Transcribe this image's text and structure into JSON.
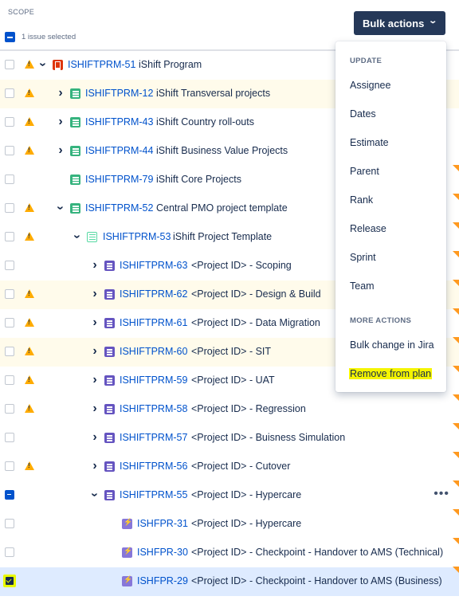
{
  "header": {
    "scope_label": "SCOPE",
    "selection_text": "1 issue selected",
    "bulk_actions_label": "Bulk actions"
  },
  "rows": [
    {
      "key": "ISHIFTPRM-51",
      "summary": "iShift Program",
      "type": "initiative",
      "warning": true,
      "expand": "down",
      "checkbox": "empty",
      "highlight": false,
      "flag": false
    },
    {
      "key": "ISHIFTPRM-12",
      "summary": "iShift Transversal projects",
      "type": "program",
      "warning": true,
      "expand": "right",
      "checkbox": "empty",
      "highlight": true,
      "flag": false
    },
    {
      "key": "ISHIFTPRM-43",
      "summary": "iShift Country roll-outs",
      "type": "program",
      "warning": true,
      "expand": "right",
      "checkbox": "empty",
      "highlight": false,
      "flag": false
    },
    {
      "key": "ISHIFTPRM-44",
      "summary": "iShift Business Value Projects",
      "type": "program",
      "warning": true,
      "expand": "right",
      "checkbox": "empty",
      "highlight": false,
      "flag": false
    },
    {
      "key": "ISHIFTPRM-79",
      "summary": "iShift Core Projects",
      "type": "program",
      "warning": false,
      "expand": "none",
      "checkbox": "empty",
      "highlight": false,
      "flag": true
    },
    {
      "key": "ISHIFTPRM-52",
      "summary": "Central PMO project template",
      "type": "program",
      "warning": true,
      "expand": "down",
      "checkbox": "empty",
      "highlight": false,
      "flag": true
    },
    {
      "key": "ISHIFTPRM-53",
      "summary": "iShift Project Template",
      "type": "program-light",
      "warning": true,
      "expand": "down",
      "checkbox": "empty",
      "highlight": false,
      "flag": true
    },
    {
      "key": "ISHIFTPRM-63",
      "summary": "<Project ID> - Scoping",
      "type": "epic",
      "warning": false,
      "expand": "right",
      "checkbox": "empty",
      "highlight": false,
      "flag": true
    },
    {
      "key": "ISHIFTPRM-62",
      "summary": "<Project ID> - Design & Build",
      "type": "epic",
      "warning": true,
      "expand": "right",
      "checkbox": "empty",
      "highlight": true,
      "flag": true
    },
    {
      "key": "ISHIFTPRM-61",
      "summary": "<Project ID> - Data Migration",
      "type": "epic",
      "warning": true,
      "expand": "right",
      "checkbox": "empty",
      "highlight": false,
      "flag": true
    },
    {
      "key": "ISHIFTPRM-60",
      "summary": "<Project ID> - SIT",
      "type": "epic",
      "warning": true,
      "expand": "right",
      "checkbox": "empty",
      "highlight": true,
      "flag": true
    },
    {
      "key": "ISHIFTPRM-59",
      "summary": "<Project ID> - UAT",
      "type": "epic",
      "warning": true,
      "expand": "right",
      "checkbox": "empty",
      "highlight": false,
      "flag": true
    },
    {
      "key": "ISHIFTPRM-58",
      "summary": "<Project ID> - Regression",
      "type": "epic",
      "warning": true,
      "expand": "right",
      "checkbox": "empty",
      "highlight": false,
      "flag": true
    },
    {
      "key": "ISHIFTPRM-57",
      "summary": "<Project ID> - Buisness Simulation",
      "type": "epic",
      "warning": false,
      "expand": "right",
      "checkbox": "empty",
      "highlight": false,
      "flag": true
    },
    {
      "key": "ISHIFTPRM-56",
      "summary": "<Project ID> - Cutover",
      "type": "epic",
      "warning": true,
      "expand": "right",
      "checkbox": "empty",
      "highlight": false,
      "flag": true
    },
    {
      "key": "ISHIFTPRM-55",
      "summary": "<Project ID> - Hypercare",
      "type": "epic",
      "warning": false,
      "expand": "down",
      "checkbox": "minus",
      "highlight": false,
      "flag": true,
      "more": true
    },
    {
      "key": "ISHFPR-31",
      "summary": "<Project ID> - Hypercare",
      "type": "task",
      "warning": false,
      "expand": "none",
      "checkbox": "empty",
      "highlight": false,
      "flag": true
    },
    {
      "key": "ISHFPR-30",
      "summary": "<Project ID> - Checkpoint - Handover to AMS (Technical)",
      "type": "task",
      "warning": false,
      "expand": "none",
      "checkbox": "empty",
      "highlight": false,
      "flag": true
    },
    {
      "key": "ISHFPR-29",
      "summary": "<Project ID> - Checkpoint - Handover to AMS (Business)",
      "type": "task",
      "warning": false,
      "expand": "none",
      "checkbox": "checked",
      "highlight": false,
      "selected": true,
      "flag": true
    }
  ],
  "menu": {
    "update_heading": "UPDATE",
    "update_items": [
      "Assignee",
      "Dates",
      "Estimate",
      "Parent",
      "Rank",
      "Release",
      "Sprint",
      "Team"
    ],
    "more_heading": "MORE ACTIONS",
    "more_items": [
      "Bulk change in Jira",
      "Remove from plan"
    ]
  },
  "more_icon": "ellipsis-icon"
}
